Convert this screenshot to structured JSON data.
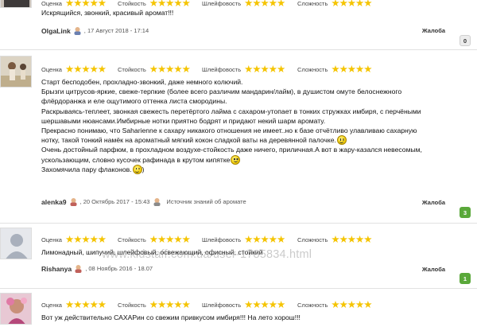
{
  "labels": {
    "scent": "Оценка",
    "longevity": "Стойкость",
    "sillage": "Шлейфовость",
    "complexity": "Сложность",
    "complain": "Жалоба"
  },
  "colors": {
    "star": "#f5c400",
    "count_gray": "#ececec",
    "count_green": "#5aa83a"
  },
  "reviews": [
    {
      "ratings": {
        "scent": 5,
        "longevity": 5,
        "sillage": 5,
        "complexity": 5
      },
      "lines": [
        "Искрящийся, звонкий, красивый аромат!!!"
      ],
      "user": "OlgaLink",
      "date": "17 Август 2018 - 17:14",
      "source": "",
      "count": "0"
    },
    {
      "ratings": {
        "scent": 5,
        "longevity": 5,
        "sillage": 5,
        "complexity": 5
      },
      "lines": [
        "Старт бесподобен, прохладно-звонкий, даже немного колючий.",
        "Брызги цитрусов-яркие, свеже-терпкие (более всего различим мандарин/лайм), в душистом омуте белоснежного",
        "флёрдоранжа и еле ощутимого оттенка листа смородины.",
        "Раскрываясь-теплеет, звонкая свежесть перетёртого лайма с сахаром-утопает в тонких стружках имбиря, с перчёными",
        "шершавыми нюансами.Имбирные нотки приятно бодрят и придают некий шарм аромату.",
        "Прекрасно понимаю, что Saharienne к сахару никакого отношения не имеет..но к базе отчётливо улавливаю сахарную",
        "нотку, такой тонкий намёк на ароматный мягкий кокон сладкой ваты на деревянной палочке.",
        "Очень достойный парфюм, в прохладном воздухе-стойкость даже ничего, приличная.А вот в жару-казался невесомым,",
        "ускользающим, словно кусочек рафинада в крутом кипятке",
        "Захомячила пару флаконов.",
        ")"
      ],
      "user": "alenka9",
      "date": "20 Октябрь 2017 - 15:43",
      "source": "Источник знаний об аромате",
      "count": "3"
    },
    {
      "ratings": {
        "scent": 5,
        "longevity": 5,
        "sillage": 5,
        "complexity": 5
      },
      "lines": [
        "Лимонадный, шипучий, шлейфовый, освежающий, офисный, стойкий"
      ],
      "user": "Rishanya",
      "date": "08 Ноябрь 2016 - 18.07",
      "source": "",
      "count": "1"
    },
    {
      "ratings": {
        "scent": 5,
        "longevity": 5,
        "sillage": 5,
        "complexity": 5
      },
      "lines": [
        "Вот уж действительно САХАРин со свежим привкусом имбиря!!! На лето хорош!!!"
      ],
      "user": "",
      "date": "",
      "source": "",
      "count": ""
    }
  ],
  "watermark": "www.kidstaff.com.ua/user-1785834.html"
}
